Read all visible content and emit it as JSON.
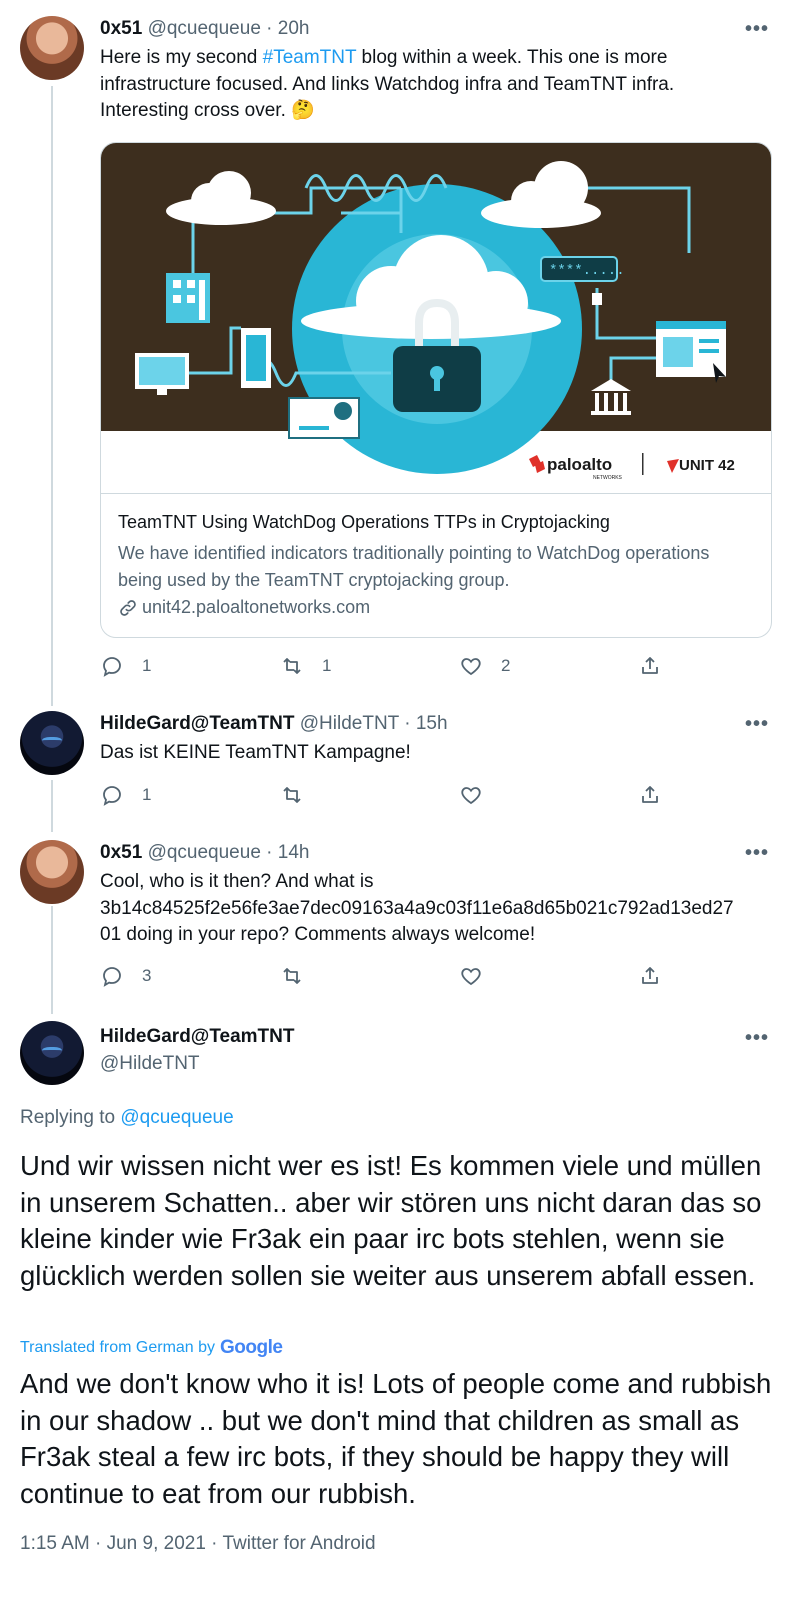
{
  "colors": {
    "accent": "#1d9bf0",
    "muted": "#536471",
    "border": "#cfd9de"
  },
  "tweet1": {
    "name": "0x51",
    "handle": "@qcuequeue",
    "time": "· 20h",
    "text_before": "Here is my second ",
    "hashtag": "#TeamTNT",
    "text_line1_after": " blog within a week. This one is more",
    "text_line2": "infrastructure focused. And links Watchdog infra and TeamTNT infra.",
    "text_line3": "Interesting cross over. 🤔",
    "card": {
      "logo_left": "paloalto",
      "logo_left_sub": "NETWORKS",
      "logo_right": "UNIT 42",
      "password_label": "****.....",
      "title": "TeamTNT Using WatchDog Operations TTPs in Cryptojacking",
      "description": "We have identified indicators traditionally pointing to WatchDog operations being used by the TeamTNT cryptojacking group.",
      "domain": "unit42.paloaltonetworks.com"
    },
    "reply_count": "1",
    "retweet_count": "1",
    "like_count": "2"
  },
  "tweet2": {
    "name": "HildeGard@TeamTNT",
    "handle": "@HildeTNT",
    "time": "· 15h",
    "text": "Das ist KEINE TeamTNT Kampagne!",
    "reply_count": "1"
  },
  "tweet3": {
    "name": "0x51",
    "handle": "@qcuequeue",
    "time": "· 14h",
    "text_line1": "Cool, who is it then? And what is",
    "text_line2": "3b14c84525f2e56fe3ae7dec09163a4a9c03f11e6a8d65b021c792ad13ed27",
    "text_line3": "01 doing in your repo? Comments always welcome!",
    "reply_count": "3"
  },
  "main": {
    "name": "HildeGard@TeamTNT",
    "handle": "@HildeTNT",
    "replying_prefix": "Replying to ",
    "replying_to": "@qcuequeue",
    "original_text": "Und wir wissen nicht wer es ist! Es kommen viele und müllen in unserem Schatten.. aber wir stören uns nicht daran das so kleine kinder wie Fr3ak ein paar irc bots stehlen, wenn sie glücklich werden sollen sie weiter aus unserem abfall essen.",
    "translated_label": "Translated from German by",
    "translator": "Google",
    "translated_text": "And we don't know who it is! Lots of people come and rubbish in our shadow .. but we don't mind that children as small as Fr3ak steal a few irc bots, if they should be happy they will continue to eat from our rubbish.",
    "timestamp": "1:15 AM · Jun 9, 2021 · Twitter for Android"
  },
  "icons": [
    "reply-icon",
    "retweet-icon",
    "like-icon",
    "share-icon",
    "more-icon",
    "link-icon"
  ]
}
